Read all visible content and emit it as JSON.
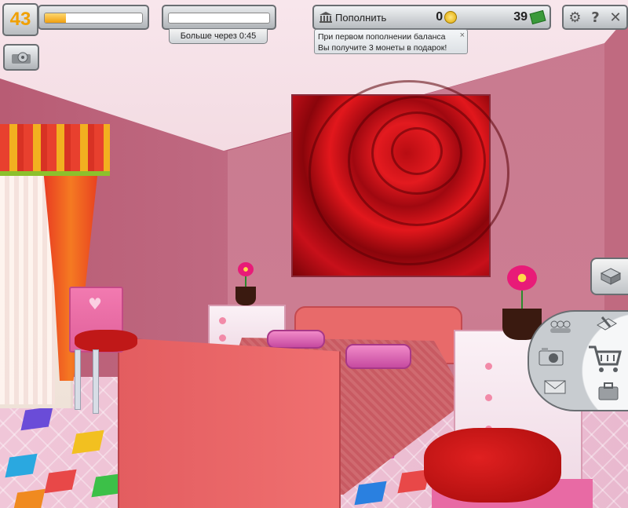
{
  "hud": {
    "level": "43",
    "xp_progress": 0.22,
    "energy_progress": 0.0,
    "timer_text": "Больше через 0:45",
    "topup_label": "Пополнить",
    "coins": "0",
    "cash": "39",
    "settings_icons": [
      "gear-icon",
      "help-icon",
      "close-icon"
    ]
  },
  "tooltip": {
    "line1": "При первом пополнении баланса",
    "line2": "Вы получите 3 монеты в подарок!",
    "close": "×"
  },
  "radial_menu": {
    "items": [
      "friends-icon",
      "edit-room-icon",
      "camera-icon",
      "shop-cart-icon",
      "mail-icon",
      "inventory-icon"
    ]
  },
  "colors": {
    "level_text": "#f0a000",
    "xp_fill": "#f0a010",
    "wall": "#c87a8f",
    "bed": "#e86a6a"
  }
}
